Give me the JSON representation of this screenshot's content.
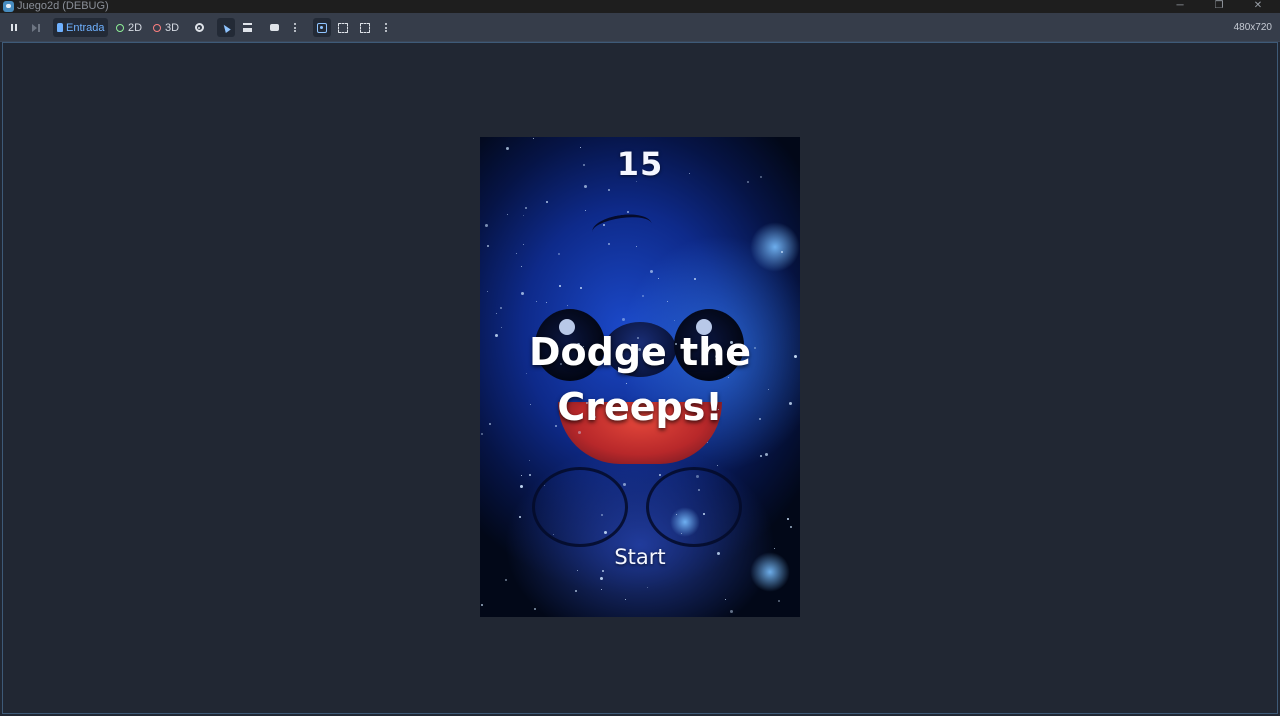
{
  "window": {
    "title": "Juego2d (DEBUG)",
    "controls": {
      "minimize": "─",
      "maximize": "❐",
      "close": "✕"
    }
  },
  "toolbar": {
    "input_label": "Entrada",
    "mode_2d_label": "2D",
    "mode_3d_label": "3D",
    "resolution": "480x720",
    "icons": [
      "pause-icon",
      "next-frame-icon",
      "hand-icon",
      "eye-icon",
      "select-arrow-icon",
      "list-icon",
      "camera-icon",
      "more-icon",
      "focus-icon",
      "expand-icon",
      "fullscreen-icon",
      "more-icon"
    ]
  },
  "game": {
    "score": "15",
    "message": "Dodge the Creeps!",
    "start_label": "Start"
  },
  "colors": {
    "accent": "#6fb1ff",
    "mode_2d": "#8eef97",
    "mode_3d": "#fc7f7f",
    "viewport_bg": "#212733",
    "toolbar_bg": "#363d4a"
  }
}
